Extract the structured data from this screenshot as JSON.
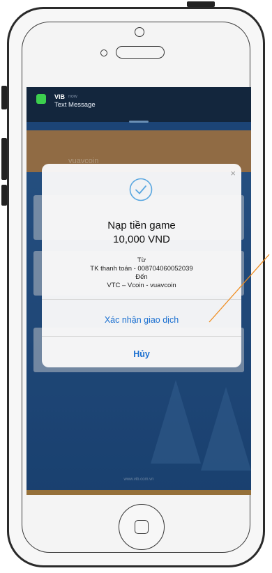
{
  "notification": {
    "app": "VIB",
    "time": "now",
    "text": "Text Message"
  },
  "app": {
    "header_text": "vuavcoin",
    "footer_url": "www.vib.com.vn"
  },
  "dialog": {
    "title": "Nạp tiền game",
    "amount": "10,000 VND",
    "from_label": "Từ",
    "from_account": "TK thanh toán - 008704060052039",
    "to_label": "Đến",
    "to_account": "VTC – Vcoin - vuavcoin",
    "confirm_label": "Xác nhận giao dịch",
    "cancel_label": "Hủy",
    "close_symbol": "×"
  },
  "colors": {
    "accent": "#1a6fd0",
    "check": "#5aa7e0",
    "annotation": "#f08c1e"
  }
}
